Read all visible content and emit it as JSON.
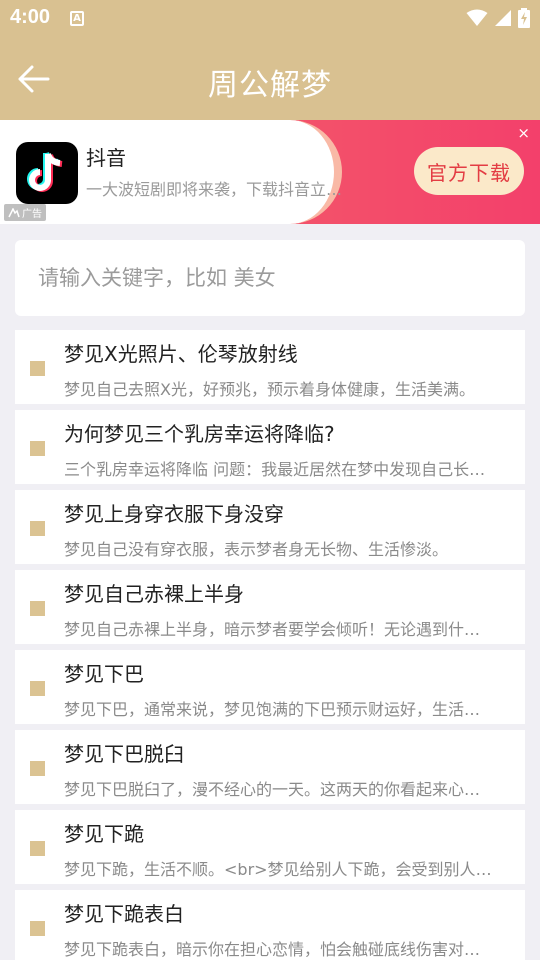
{
  "status_bar": {
    "time": "4:00",
    "notification_icon": "A"
  },
  "header": {
    "title": "周公解梦"
  },
  "ad": {
    "title": "抖音",
    "description": "一大波短剧即将来袭，下载抖音立即观看",
    "tag": "广告",
    "cta": "官方下载",
    "close": "×"
  },
  "search": {
    "placeholder": "请输入关键字，比如 美女",
    "value": ""
  },
  "items": [
    {
      "title": "梦见X光照片、伦琴放射线",
      "desc": "梦见自己去照X光，好预兆，预示着身体健康，生活美满。"
    },
    {
      "title": "为何梦见三个乳房幸运将降临?",
      "desc": "三个乳房幸运将降临 问题：我最近居然在梦中发现自己长了三个乳房。"
    },
    {
      "title": "梦见上身穿衣服下身没穿",
      "desc": "梦见自己没有穿衣服，表示梦者身无长物、生活惨淡。"
    },
    {
      "title": "梦见自己赤裸上半身",
      "desc": "梦见自己赤裸上半身，暗示梦者要学会倾听！无论遇到什么事情。"
    },
    {
      "title": "梦见下巴",
      "desc": "梦见下巴，通常来说，梦见饱满的下巴预示财运好，生活富足。"
    },
    {
      "title": "梦见下巴脱臼",
      "desc": "梦见下巴脱臼了，漫不经心的一天。这两天的你看起来心不在焉。"
    },
    {
      "title": "梦见下跪",
      "desc": "梦见下跪，生活不顺。<br>梦见给别人下跪，会受到别人的帮助。"
    },
    {
      "title": "梦见下跪表白",
      "desc": "梦见下跪表白，暗示你在担心恋情，怕会触碰底线伤害对方。"
    }
  ]
}
